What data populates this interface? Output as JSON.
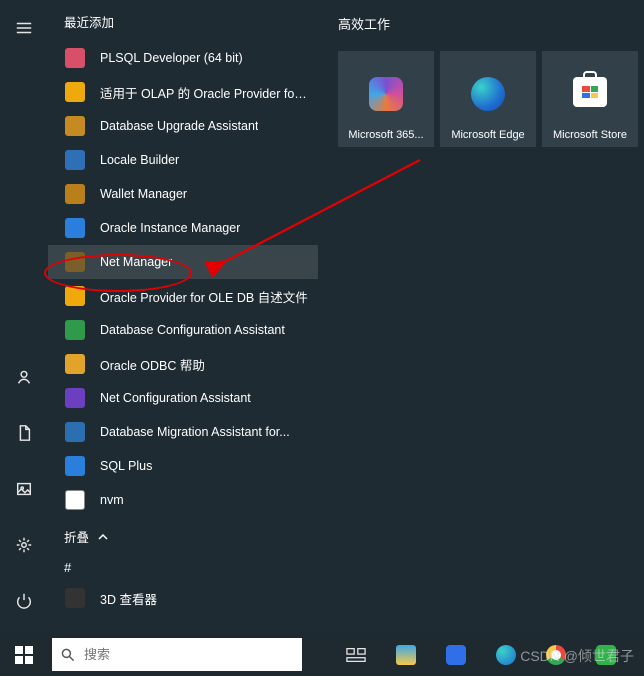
{
  "sections": {
    "recent": "最近添加",
    "tiles": "高效工作",
    "fold": "折叠",
    "letter": "#"
  },
  "rail": {
    "hamburger": "menu",
    "user": "user",
    "documents": "documents",
    "pictures": "pictures",
    "settings": "settings",
    "power": "power"
  },
  "apps": [
    {
      "icon": "plsql",
      "label": "PLSQL Developer (64 bit)",
      "bg": "#d94f6a"
    },
    {
      "icon": "olap",
      "label": "适用于 OLAP 的 Oracle Provider for...",
      "bg": "#f0a90d"
    },
    {
      "icon": "dbupg",
      "label": "Database Upgrade Assistant",
      "bg": "#c58a22"
    },
    {
      "icon": "locale",
      "label": "Locale Builder",
      "bg": "#2f6fb5"
    },
    {
      "icon": "wallet",
      "label": "Wallet Manager",
      "bg": "#b97f1a"
    },
    {
      "icon": "instance",
      "label": "Oracle Instance Manager",
      "bg": "#2b7fdc"
    },
    {
      "icon": "netmgr",
      "label": "Net Manager",
      "bg": "#7b5f2a",
      "selected": true
    },
    {
      "icon": "oledb",
      "label": "Oracle Provider for OLE DB 自述文件",
      "bg": "#f0a90d"
    },
    {
      "icon": "dbca",
      "label": "Database Configuration Assistant",
      "bg": "#2f9a4a"
    },
    {
      "icon": "odbc",
      "label": "Oracle ODBC 帮助",
      "bg": "#e2a32a"
    },
    {
      "icon": "netca",
      "label": "Net Configuration Assistant",
      "bg": "#6b3fbf"
    },
    {
      "icon": "dbmig",
      "label": "Database Migration Assistant for...",
      "bg": "#2b6fb0"
    },
    {
      "icon": "sqlplus",
      "label": "SQL Plus",
      "bg": "#2b7fdc"
    },
    {
      "icon": "nvm",
      "label": "nvm",
      "bg": "#ffffff"
    }
  ],
  "letter_apps": [
    {
      "icon": "3d",
      "label": "3D 查看器",
      "bg": "#333"
    }
  ],
  "tiles": [
    {
      "label": "Microsoft 365...",
      "icon": "m365"
    },
    {
      "label": "Microsoft Edge",
      "icon": "edge"
    },
    {
      "label": "Microsoft Store",
      "icon": "store"
    }
  ],
  "search": {
    "placeholder": "搜索"
  },
  "watermark": "CSDN @倾世君子"
}
